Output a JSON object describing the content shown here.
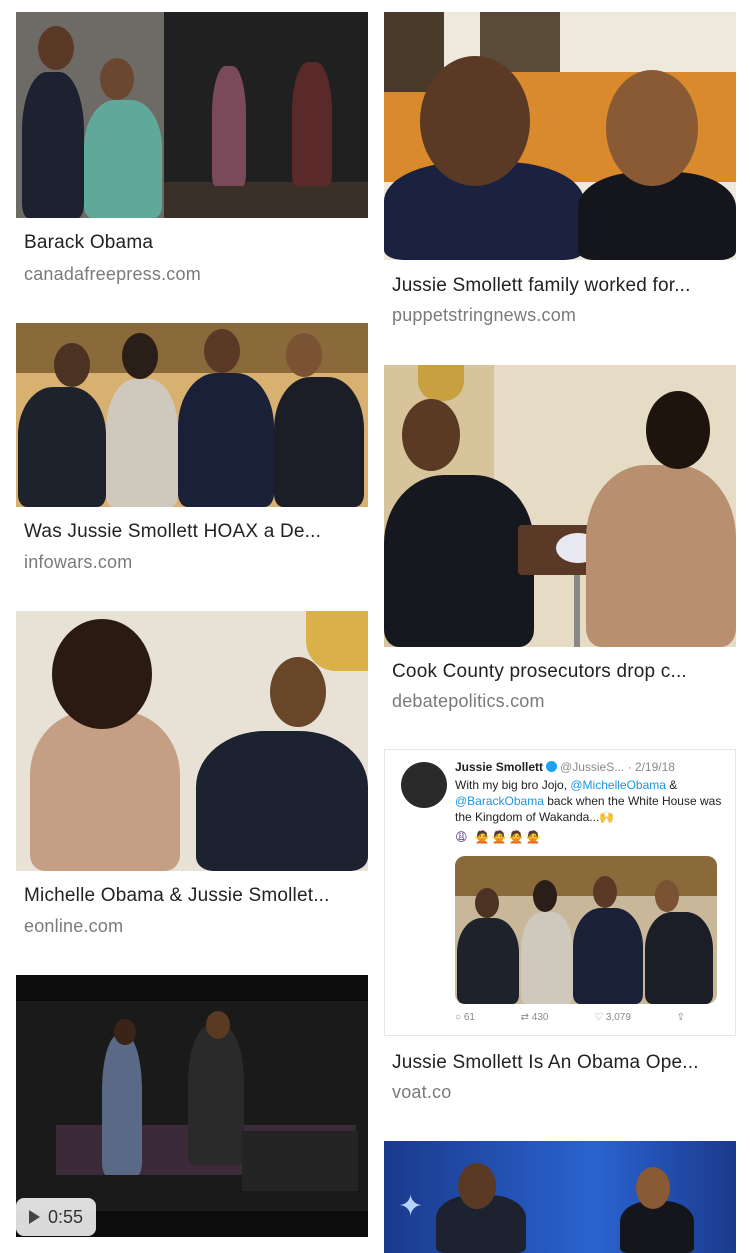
{
  "results": [
    {
      "title": "Barack Obama",
      "source": "canadafreepress.com"
    },
    {
      "title": "Jussie Smollett family worked for...",
      "source": "puppetstringnews.com"
    },
    {
      "title": "Was Jussie Smollett HOAX a De...",
      "source": "infowars.com"
    },
    {
      "title": "Cook County prosecutors drop c...",
      "source": "debatepolitics.com"
    },
    {
      "title": "Michelle Obama & Jussie Smollet...",
      "source": "eonline.com"
    },
    {
      "title": "Jussie Smollett Is An Obama Ope...",
      "source": "voat.co"
    }
  ],
  "video": {
    "duration": "0:55",
    "play_icon": "play-icon"
  },
  "tweet": {
    "name": "Jussie Smollett",
    "handle": "@JussieS...",
    "date": "· 2/19/18",
    "text_1": "With my big bro Jojo, ",
    "mention_1": "@MichelleObama",
    "text_2": " & ",
    "mention_2": "@BarackObama",
    "text_3": " back when the White House was the Kingdom of Wakanda...🙌",
    "emoji_line": "😩 🙅🙅🙅🙅",
    "replies": "61",
    "retweets": "430",
    "likes": "3,079"
  },
  "colors": {
    "title": "#222222",
    "source": "#7a7a7a",
    "link": "#1b95e0"
  }
}
